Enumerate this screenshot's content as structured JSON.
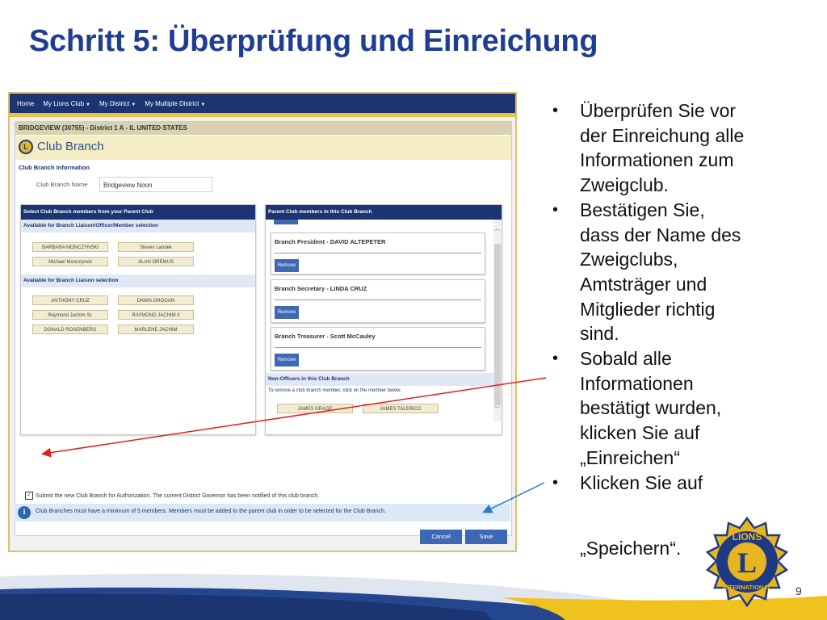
{
  "slide": {
    "title": "Schritt 5: Überprüfung und Einreichung",
    "page_number": "9"
  },
  "screenshot": {
    "nav": [
      {
        "label": "Home",
        "caret": false
      },
      {
        "label": "My Lions Club",
        "caret": true
      },
      {
        "label": "My District",
        "caret": true
      },
      {
        "label": "My Multiple District",
        "caret": true
      }
    ],
    "club_header": "BRIDGEVIEW (30755) - District 1 A - IL UNITED STATES",
    "page_title": "Club Branch",
    "info_section": "Club Branch Information",
    "name_label": "Club Branch Name",
    "name_value": "Bridgeview Noon",
    "left_panel": {
      "title": "Select Club Branch members from your Parent Club",
      "section1": "Available for Branch Liaison/Officer/Member selection",
      "section1_members": [
        "BARBARA MONCZYNSKI",
        "Steven Landek",
        "Michael Monczynski",
        "ALAN OREMUS"
      ],
      "section2": "Available for Branch Liaison selection",
      "section2_members": [
        "ANTHONY CRUZ",
        "DAWN GROGAN",
        "Raymond Jachim Sr.",
        "RAYMOND JACHIM II",
        "DONALD ROSENBERG",
        "MARLENE JACHIM"
      ]
    },
    "right_panel": {
      "title": "Parent Club members in this Club Branch",
      "officers": [
        {
          "title": "Branch President - DAVID ALTEPETER",
          "button": "Remove"
        },
        {
          "title": "Branch Secretary - LINDA CRUZ",
          "button": "Remove"
        },
        {
          "title": "Branch Treasurer - Scott McCauley",
          "button": "Remove"
        }
      ],
      "non_officers_title": "Non-Officers in this Club Branch",
      "non_officers_hint": "To remove a club branch member, click on the member below.",
      "non_officers": [
        "JAMES GRAGE",
        "JAMES TALERICO"
      ]
    },
    "submit_checked": true,
    "submit_text": "Submit the new Club Branch for Authorization. The current District Governor has been notified of this club branch.",
    "notice": "Club Branches must have a minimum of 5 members. Members must be added to the parent club in order to be selected for the Club Branch.",
    "cancel_label": "Cancel",
    "save_label": "Save"
  },
  "bullets": [
    "Überprüfen Sie vor der Einreichung alle Informationen zum Zweigclub.",
    "Bestätigen Sie, dass der Name des Zweigclubs, Amtsträger und Mitglieder richtig sind.",
    "Sobald alle Informationen bestätigt wurden, klicken Sie auf „Einreichen“",
    "Klicken Sie auf"
  ],
  "bullet_tail": "„Speichern“.",
  "logo": {
    "top_text": "LIONS",
    "center_letter": "L",
    "bottom_text": "INTERNATIONAL",
    "colors": {
      "gold": "#e7b51f",
      "blue": "#1e3a85"
    }
  },
  "colors": {
    "title_blue": "#1f3e92",
    "nav_navy": "#1d3473",
    "button_blue": "#3d68b4",
    "arrow_red": "#e02020",
    "arrow_blue": "#2a78c8"
  }
}
